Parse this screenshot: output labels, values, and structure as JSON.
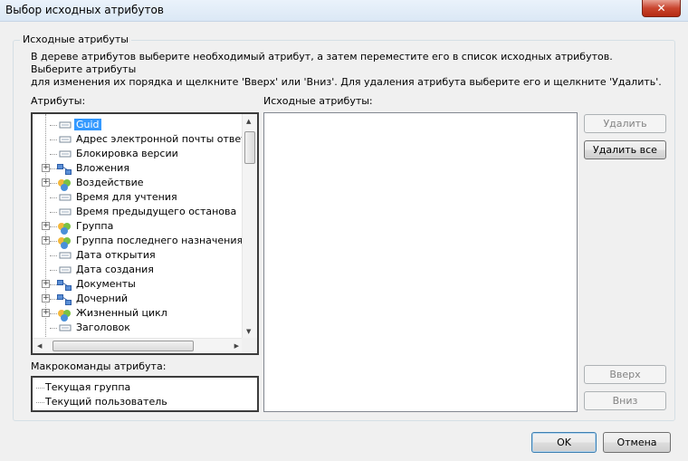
{
  "window": {
    "title": "Выбор исходных атрибутов",
    "close_glyph": "✕"
  },
  "group": {
    "legend": "Исходные атрибуты",
    "description_line1": "В дереве атрибутов выберите необходимый атрибут, а затем переместите его в список исходных атрибутов. Выберите атрибуты",
    "description_line2": "для изменения их порядка и щелкните 'Вверх' или 'Вниз'. Для удаления атрибута выберите его и щелкните 'Удалить'."
  },
  "attributes_label": "Атрибуты:",
  "source_attributes_label": "Исходные атрибуты:",
  "macros_label": "Макрокоманды атрибута:",
  "tree": {
    "items": [
      {
        "label": "Guid",
        "expandable": false,
        "icon": "field-icon",
        "selected": true
      },
      {
        "label": "Адрес электронной почты ответа",
        "expandable": false,
        "icon": "field-icon",
        "selected": false
      },
      {
        "label": "Блокировка версии",
        "expandable": false,
        "icon": "field-icon",
        "selected": false
      },
      {
        "label": "Вложения",
        "expandable": true,
        "icon": "relation-icon",
        "selected": false
      },
      {
        "label": "Воздействие",
        "expandable": true,
        "icon": "group-icon",
        "selected": false
      },
      {
        "label": "Время для учтения",
        "expandable": false,
        "icon": "field-icon",
        "selected": false
      },
      {
        "label": "Время предыдущего останова",
        "expandable": false,
        "icon": "field-icon",
        "selected": false
      },
      {
        "label": "Группа",
        "expandable": true,
        "icon": "group-icon",
        "selected": false
      },
      {
        "label": "Группа последнего назначения",
        "expandable": true,
        "icon": "group-icon",
        "selected": false
      },
      {
        "label": "Дата открытия",
        "expandable": false,
        "icon": "field-icon",
        "selected": false
      },
      {
        "label": "Дата создания",
        "expandable": false,
        "icon": "field-icon",
        "selected": false
      },
      {
        "label": "Документы",
        "expandable": true,
        "icon": "relation-icon",
        "selected": false
      },
      {
        "label": "Дочерний",
        "expandable": true,
        "icon": "relation-icon",
        "selected": false
      },
      {
        "label": "Жизненный цикл",
        "expandable": true,
        "icon": "group-icon",
        "selected": false
      },
      {
        "label": "Заголовок",
        "expandable": false,
        "icon": "field-icon",
        "selected": false
      }
    ]
  },
  "macros": {
    "items": [
      "Текущая группа",
      "Текущий пользователь"
    ]
  },
  "buttons": {
    "remove": "Удалить",
    "remove_all": "Удалить все",
    "up": "Вверх",
    "down": "Вниз",
    "ok": "OK",
    "cancel": "Отмена"
  },
  "colors": {
    "selection": "#3399ff",
    "dialog_bg": "#f0f0f0"
  }
}
